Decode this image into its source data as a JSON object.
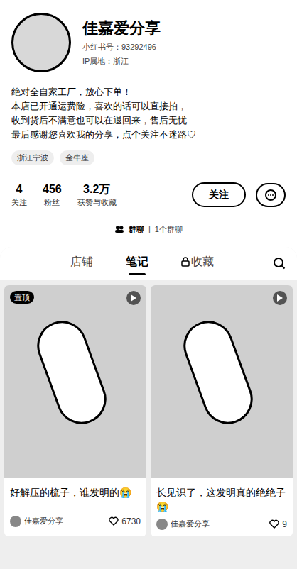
{
  "profile": {
    "name": "佳嘉爱分享",
    "id": "小红书号：93292496",
    "ip": "IP属地：浙江",
    "bio": [
      "绝对全自家工厂，放心下单！",
      "本店已开通运费险，喜欢的话可以直接拍，",
      "收到货后不满意也可以在退回来，售后无忧",
      "最后感谢您喜欢我的分享，点个关注不迷路♡"
    ],
    "tags": [
      "浙江宁波",
      "金牛座"
    ],
    "stats": [
      {
        "value": "4",
        "label": "关注"
      },
      {
        "value": "456",
        "label": "粉丝"
      },
      {
        "value": "3.2万",
        "label": "获赞与收藏"
      }
    ],
    "follow_button": "关注",
    "group": {
      "label": "群聊",
      "count": "1个群聊"
    }
  },
  "tabs": [
    {
      "label": "店铺",
      "selected": false,
      "locked": false
    },
    {
      "label": "笔记",
      "selected": true,
      "locked": false
    },
    {
      "label": "收藏",
      "selected": false,
      "locked": true
    }
  ],
  "notes": [
    {
      "title": "好解压的梳子，谁发明的😭",
      "author": "佳嘉爱分享",
      "likes": "6730",
      "badge": "置顶"
    },
    {
      "title": "长见识了，这发明真的绝绝子😭",
      "author": "佳嘉爱分享",
      "likes": "9"
    }
  ]
}
